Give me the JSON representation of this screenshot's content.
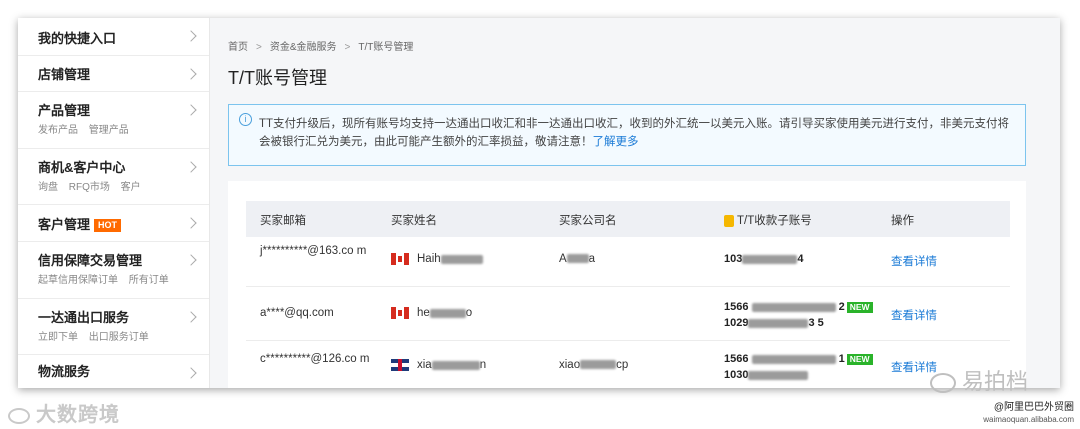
{
  "sidebar": {
    "items": [
      {
        "title": "我的快捷入口",
        "subs": []
      },
      {
        "title": "店铺管理",
        "subs": []
      },
      {
        "title": "产品管理",
        "subs": [
          "发布产品",
          "管理产品"
        ]
      },
      {
        "title": "商机&客户中心",
        "subs": [
          "询盘",
          "RFQ市场",
          "客户"
        ]
      },
      {
        "title": "客户管理",
        "badge": "HOT",
        "subs": []
      },
      {
        "title": "信用保障交易管理",
        "subs": [
          "起草信用保障订单",
          "所有订单"
        ]
      },
      {
        "title": "一达通出口服务",
        "subs": [
          "立即下单",
          "出口服务订单"
        ]
      },
      {
        "title": "物流服务",
        "subs": []
      }
    ]
  },
  "breadcrumb": {
    "home": "首页",
    "level2": "资金&金融服务",
    "current": "T/T账号管理",
    "sep": ">"
  },
  "page_title": "T/T账号管理",
  "notice": {
    "icon": "info-icon",
    "text": "TT支付升级后，现所有账号均支持一达通出口收汇和非一达通出口收汇，收到的外汇统一以美元入账。请引导买家使用美元进行支付，非美元支付将会被银行汇兑为美元，由此可能产生额外的汇率损益，敬请注意！",
    "link": "了解更多"
  },
  "table": {
    "headers": [
      "买家邮箱",
      "买家姓名",
      "买家公司名",
      "T/T收款子账号",
      "操作"
    ],
    "rows": [
      {
        "email": "j**********@163.co m",
        "flag": "canada",
        "name": "Haih",
        "company_a": "A",
        "company_b": "a",
        "accounts": [
          {
            "prefix": "103",
            "suffix": "4",
            "new": false
          }
        ],
        "action": "查看详情"
      },
      {
        "email": "a****@qq.com",
        "flag": "canada",
        "name": "he",
        "name_end": "o",
        "company_a": "",
        "company_b": "",
        "accounts": [
          {
            "prefix": "1566",
            "suffix": "2",
            "new": true,
            "badge": "NEW"
          },
          {
            "prefix": "1029",
            "suffix": "3 5",
            "new": false
          }
        ],
        "action": "查看详情"
      },
      {
        "email": "c**********@126.co m",
        "flag": "uk",
        "name": "xia",
        "name_end": "n",
        "company_a": "xiao",
        "company_b": "cp",
        "accounts": [
          {
            "prefix": "1566",
            "suffix": "1",
            "new": true,
            "badge": "NEW"
          },
          {
            "prefix": "1030",
            "suffix": "",
            "new": false
          }
        ],
        "action": "查看详情"
      }
    ]
  },
  "watermarks": {
    "left": "大数跨境",
    "right": "易拍档",
    "bottom_right": "@阿里巴巴外贸圈",
    "bottom_right_url": "waimaoquan.alibaba.com"
  }
}
